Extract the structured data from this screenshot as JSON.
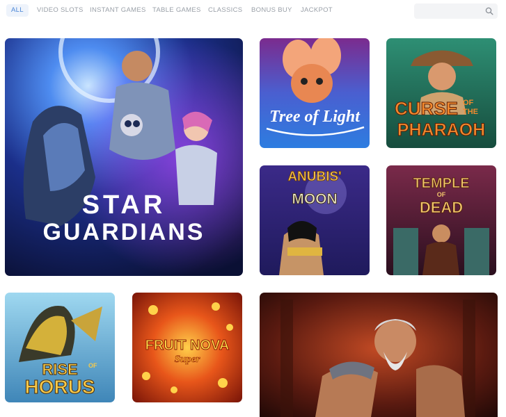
{
  "nav": {
    "tabs": [
      {
        "label": "ALL",
        "active": true
      },
      {
        "label": "VIDEO SLOTS",
        "active": false
      },
      {
        "label": "INSTANT GAMES",
        "active": false
      },
      {
        "label": "TABLE GAMES",
        "active": false
      },
      {
        "label": "CLASSICS",
        "active": false
      },
      {
        "label": "BONUS BUY",
        "active": false
      },
      {
        "label": "JACKPOT",
        "active": false
      }
    ],
    "search": {
      "placeholder": "",
      "value": "",
      "icon": "search-icon"
    }
  },
  "games": {
    "star_guardians": {
      "line1": "STAR",
      "line2": "GUARDIANS"
    },
    "tree_of_light": {
      "title": "Tree of Light"
    },
    "curse_of_the_pharaoh": {
      "line1": "CURSE",
      "of": "OF",
      "the": "THE",
      "line2": "PHARAOH"
    },
    "anubis_moon": {
      "line1": "ANUBIS'",
      "line2": "MOON"
    },
    "temple_of_dead": {
      "line1": "TEMPLE",
      "of": "OF",
      "line2": "DEAD"
    },
    "rise_of_horus": {
      "line1": "RISE",
      "of": "OF",
      "line2": "HORUS"
    },
    "fruit_nova": {
      "line1": "FRUIT NOVA",
      "line2": "Super"
    },
    "warrior_game": {
      "title": ""
    }
  },
  "colors": {
    "active_tab_bg": "#eef3fb",
    "active_tab_text": "#4a86d6",
    "tab_text": "#9aa0a8"
  }
}
